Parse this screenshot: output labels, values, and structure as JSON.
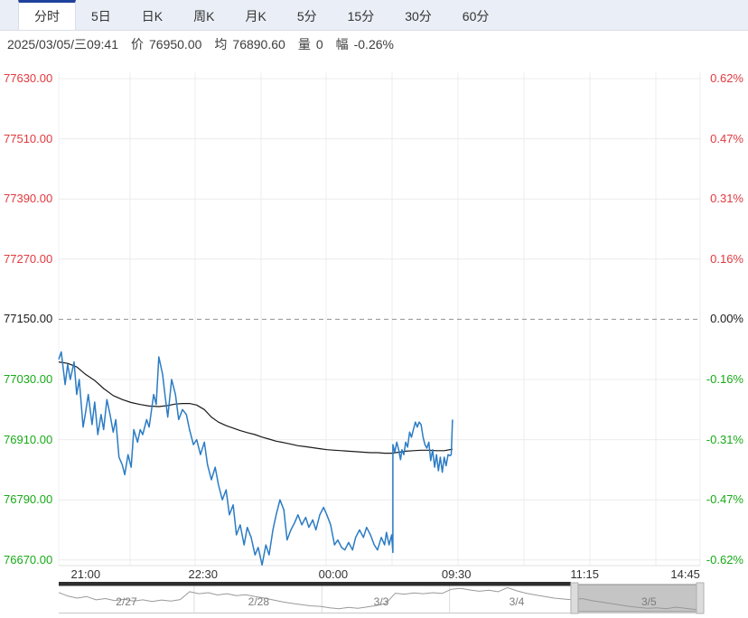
{
  "palette": {
    "up_color": "#e0393e",
    "down_color": "#18a918",
    "price_line_color": "#2b7cc4",
    "avg_line_color": "#1a1a1a",
    "active_tab_accent": "#1f419b",
    "fullscreen_icon_color": "#4a7bd4",
    "grid_color": "#ececec",
    "zero_line_color": "#909090",
    "navigator_line_color": "#9a9a9a",
    "navigator_selection_fill": "rgba(150,150,150,0.55)",
    "navigator_move_bar_color": "#2e2e2e"
  },
  "tabs": {
    "items": [
      {
        "label": "分时",
        "active": true
      },
      {
        "label": "5日",
        "active": false
      },
      {
        "label": "日K",
        "active": false
      },
      {
        "label": "周K",
        "active": false
      },
      {
        "label": "月K",
        "active": false
      },
      {
        "label": "5分",
        "active": false
      },
      {
        "label": "15分",
        "active": false
      },
      {
        "label": "30分",
        "active": false
      },
      {
        "label": "60分",
        "active": false
      }
    ],
    "fullscreen_icon": "fullscreen-expand"
  },
  "status": {
    "datetime": "2025/03/05/三09:41",
    "price_label": "价",
    "price_value": "76950.00",
    "avg_label": "均",
    "avg_value": "76890.60",
    "volume_label": "量",
    "volume_value": "0",
    "change_label": "幅",
    "change_value": "-0.26%"
  },
  "chart_data": {
    "type": "line",
    "title": "分时走势",
    "legend_position": "none",
    "grid": true,
    "y_axis_left": {
      "labels": [
        "77630.00",
        "77510.00",
        "77390.00",
        "77270.00",
        "77150.00",
        "77030.00",
        "76910.00",
        "76790.00",
        "76670.00"
      ],
      "values": [
        77630,
        77510,
        77390,
        77270,
        77150,
        77030,
        76910,
        76790,
        76670
      ],
      "base_value": 77150
    },
    "y_axis_right": {
      "labels": [
        "0.62%",
        "0.47%",
        "0.31%",
        "0.16%",
        "0.00%",
        "-0.16%",
        "-0.31%",
        "-0.47%",
        "-0.62%"
      ]
    },
    "x_axis_labels": [
      {
        "label": "21:00",
        "frac": 0.042
      },
      {
        "label": "22:30",
        "frac": 0.225
      },
      {
        "label": "00:00",
        "frac": 0.428
      },
      {
        "label": "09:30",
        "frac": 0.62
      },
      {
        "label": "11:15",
        "frac": 0.82
      },
      {
        "label": "14:45",
        "frac": 0.977
      }
    ],
    "series": [
      {
        "name": "price",
        "points": [
          [
            0.0,
            77070
          ],
          [
            0.004,
            77085
          ],
          [
            0.01,
            77020
          ],
          [
            0.014,
            77060
          ],
          [
            0.018,
            77030
          ],
          [
            0.024,
            77065
          ],
          [
            0.028,
            77000
          ],
          [
            0.032,
            77030
          ],
          [
            0.038,
            76935
          ],
          [
            0.042,
            76965
          ],
          [
            0.046,
            77000
          ],
          [
            0.052,
            76940
          ],
          [
            0.056,
            76985
          ],
          [
            0.061,
            76920
          ],
          [
            0.066,
            76960
          ],
          [
            0.07,
            76930
          ],
          [
            0.075,
            76990
          ],
          [
            0.08,
            76960
          ],
          [
            0.085,
            76925
          ],
          [
            0.089,
            76950
          ],
          [
            0.094,
            76875
          ],
          [
            0.099,
            76860
          ],
          [
            0.103,
            76840
          ],
          [
            0.108,
            76880
          ],
          [
            0.113,
            76855
          ],
          [
            0.117,
            76930
          ],
          [
            0.123,
            76905
          ],
          [
            0.127,
            76930
          ],
          [
            0.131,
            76920
          ],
          [
            0.137,
            76950
          ],
          [
            0.141,
            76935
          ],
          [
            0.148,
            77000
          ],
          [
            0.152,
            76980
          ],
          [
            0.156,
            77075
          ],
          [
            0.162,
            77040
          ],
          [
            0.166,
            76995
          ],
          [
            0.17,
            76955
          ],
          [
            0.176,
            77030
          ],
          [
            0.182,
            77000
          ],
          [
            0.187,
            76950
          ],
          [
            0.193,
            76970
          ],
          [
            0.199,
            76960
          ],
          [
            0.204,
            76930
          ],
          [
            0.21,
            76900
          ],
          [
            0.215,
            76910
          ],
          [
            0.221,
            76880
          ],
          [
            0.227,
            76905
          ],
          [
            0.232,
            76860
          ],
          [
            0.238,
            76830
          ],
          [
            0.244,
            76855
          ],
          [
            0.249,
            76820
          ],
          [
            0.255,
            76790
          ],
          [
            0.261,
            76810
          ],
          [
            0.266,
            76760
          ],
          [
            0.272,
            76780
          ],
          [
            0.277,
            76720
          ],
          [
            0.283,
            76740
          ],
          [
            0.289,
            76700
          ],
          [
            0.294,
            76735
          ],
          [
            0.3,
            76715
          ],
          [
            0.306,
            76680
          ],
          [
            0.311,
            76695
          ],
          [
            0.317,
            76660
          ],
          [
            0.323,
            76700
          ],
          [
            0.328,
            76680
          ],
          [
            0.334,
            76730
          ],
          [
            0.339,
            76760
          ],
          [
            0.345,
            76790
          ],
          [
            0.351,
            76770
          ],
          [
            0.356,
            76710
          ],
          [
            0.362,
            76730
          ],
          [
            0.368,
            76745
          ],
          [
            0.373,
            76760
          ],
          [
            0.379,
            76740
          ],
          [
            0.385,
            76755
          ],
          [
            0.39,
            76735
          ],
          [
            0.396,
            76750
          ],
          [
            0.401,
            76730
          ],
          [
            0.407,
            76760
          ],
          [
            0.413,
            76775
          ],
          [
            0.418,
            76760
          ],
          [
            0.424,
            76740
          ],
          [
            0.43,
            76700
          ],
          [
            0.435,
            76710
          ],
          [
            0.441,
            76695
          ],
          [
            0.446,
            76690
          ],
          [
            0.452,
            76705
          ],
          [
            0.458,
            76690
          ],
          [
            0.463,
            76715
          ],
          [
            0.469,
            76730
          ],
          [
            0.475,
            76715
          ],
          [
            0.48,
            76735
          ],
          [
            0.486,
            76720
          ],
          [
            0.492,
            76700
          ],
          [
            0.497,
            76690
          ],
          [
            0.503,
            76715
          ],
          [
            0.508,
            76700
          ],
          [
            0.511,
            76725
          ],
          [
            0.515,
            76700
          ],
          [
            0.519,
            76720
          ],
          [
            0.521,
            76685
          ],
          [
            0.521,
            76900
          ],
          [
            0.524,
            76885
          ],
          [
            0.527,
            76905
          ],
          [
            0.53,
            76890
          ],
          [
            0.533,
            76870
          ],
          [
            0.535,
            76890
          ],
          [
            0.538,
            76880
          ],
          [
            0.541,
            76905
          ],
          [
            0.544,
            76895
          ],
          [
            0.547,
            76925
          ],
          [
            0.55,
            76915
          ],
          [
            0.553,
            76930
          ],
          [
            0.556,
            76945
          ],
          [
            0.559,
            76935
          ],
          [
            0.562,
            76945
          ],
          [
            0.565,
            76940
          ],
          [
            0.568,
            76915
          ],
          [
            0.571,
            76900
          ],
          [
            0.574,
            76893
          ],
          [
            0.577,
            76905
          ],
          [
            0.58,
            76868
          ],
          [
            0.583,
            76890
          ],
          [
            0.586,
            76855
          ],
          [
            0.589,
            76880
          ],
          [
            0.592,
            76848
          ],
          [
            0.595,
            76875
          ],
          [
            0.598,
            76845
          ],
          [
            0.601,
            76875
          ],
          [
            0.604,
            76858
          ],
          [
            0.607,
            76880
          ],
          [
            0.61,
            76878
          ],
          [
            0.612,
            76880
          ],
          [
            0.614,
            76950
          ]
        ]
      },
      {
        "name": "average",
        "points": [
          [
            0.0,
            77065
          ],
          [
            0.014,
            77062
          ],
          [
            0.028,
            77055
          ],
          [
            0.042,
            77040
          ],
          [
            0.056,
            77028
          ],
          [
            0.07,
            77012
          ],
          [
            0.085,
            76998
          ],
          [
            0.099,
            76990
          ],
          [
            0.113,
            76984
          ],
          [
            0.127,
            76980
          ],
          [
            0.141,
            76977
          ],
          [
            0.156,
            76976
          ],
          [
            0.17,
            76978
          ],
          [
            0.182,
            76981
          ],
          [
            0.193,
            76982
          ],
          [
            0.204,
            76982
          ],
          [
            0.215,
            76979
          ],
          [
            0.227,
            76970
          ],
          [
            0.238,
            76955
          ],
          [
            0.249,
            76945
          ],
          [
            0.261,
            76938
          ],
          [
            0.272,
            76933
          ],
          [
            0.283,
            76928
          ],
          [
            0.294,
            76924
          ],
          [
            0.306,
            76920
          ],
          [
            0.317,
            76915
          ],
          [
            0.328,
            76911
          ],
          [
            0.339,
            76907
          ],
          [
            0.351,
            76904
          ],
          [
            0.362,
            76901
          ],
          [
            0.373,
            76898
          ],
          [
            0.385,
            76896
          ],
          [
            0.396,
            76894
          ],
          [
            0.407,
            76892
          ],
          [
            0.418,
            76890
          ],
          [
            0.43,
            76889
          ],
          [
            0.441,
            76888
          ],
          [
            0.452,
            76887
          ],
          [
            0.463,
            76886
          ],
          [
            0.475,
            76885
          ],
          [
            0.486,
            76884
          ],
          [
            0.497,
            76884
          ],
          [
            0.508,
            76883
          ],
          [
            0.519,
            76883
          ],
          [
            0.53,
            76885
          ],
          [
            0.541,
            76887
          ],
          [
            0.553,
            76888
          ],
          [
            0.565,
            76889
          ],
          [
            0.577,
            76889
          ],
          [
            0.589,
            76888
          ],
          [
            0.601,
            76888
          ],
          [
            0.614,
            76891
          ]
        ]
      }
    ],
    "navigator": {
      "dates": [
        {
          "label": "2/27",
          "frac": 0.105
        },
        {
          "label": "2/28",
          "frac": 0.31
        },
        {
          "label": "3/3",
          "frac": 0.5
        },
        {
          "label": "3/4",
          "frac": 0.71
        },
        {
          "label": "3/5",
          "frac": 0.915
        }
      ],
      "separator_fracs": [
        0.21,
        0.408,
        0.606,
        0.805
      ],
      "values": [
        75,
        60,
        52,
        58,
        45,
        50,
        42,
        47,
        40,
        45,
        38,
        44,
        40,
        46,
        78,
        70,
        74,
        65,
        70,
        62,
        66,
        58,
        52,
        44,
        36,
        30,
        25,
        20,
        18,
        12,
        8,
        14,
        10,
        16,
        22,
        30,
        72,
        68,
        73,
        70,
        74,
        71,
        88,
        92,
        85,
        80,
        84,
        78,
        95,
        82,
        72,
        65,
        58,
        52,
        48,
        45,
        50,
        42,
        36,
        30,
        24,
        18,
        14,
        10,
        12,
        8,
        15,
        10,
        6,
        4
      ],
      "selected_from": 0.794,
      "selected_to": 1.0
    }
  }
}
